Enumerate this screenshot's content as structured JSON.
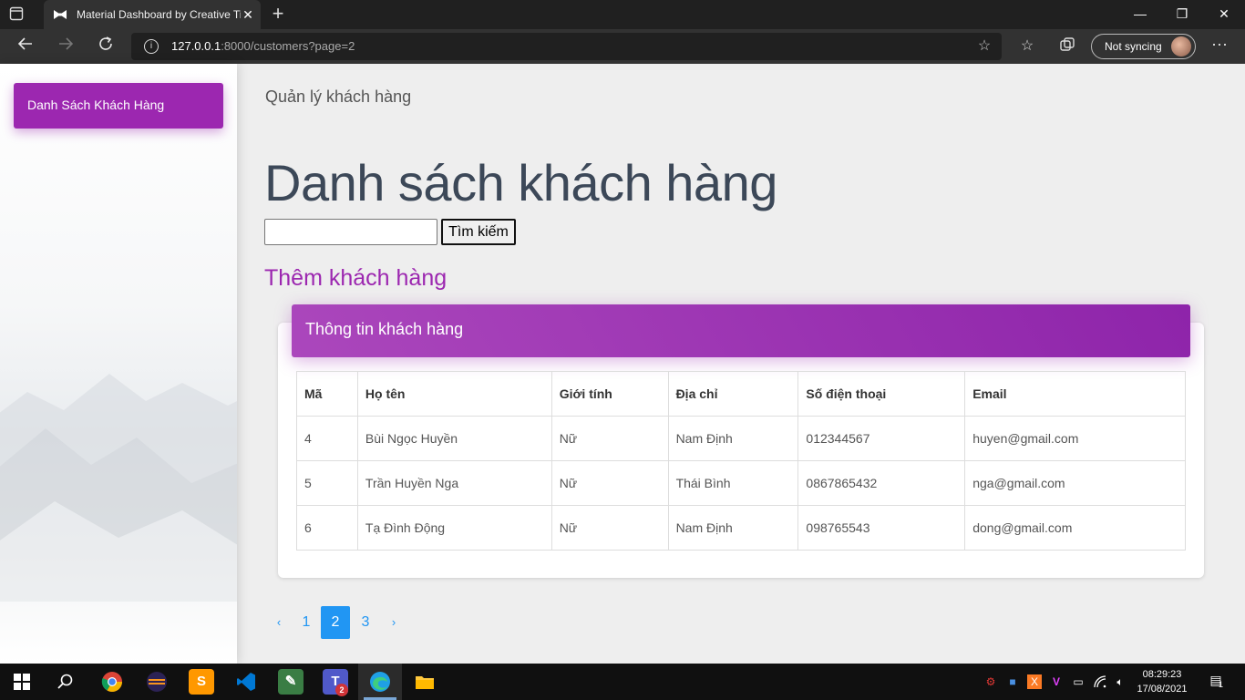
{
  "browser": {
    "tab_title": "Material Dashboard by Creative Tim",
    "tab_close": "✕",
    "new_tab": "+",
    "url_host": "127.0.0.1",
    "url_rest": ":8000/customers?page=2",
    "sync_label": "Not syncing",
    "window_minimize": "—",
    "window_restore": "❐",
    "window_close": "✕"
  },
  "sidebar": {
    "items": [
      {
        "label": "Danh Sách Khách Hàng"
      }
    ]
  },
  "header": {
    "brand": "Quản lý khách hàng"
  },
  "main": {
    "title": "Danh sách khách hàng",
    "search": {
      "value": "",
      "button_label": "Tìm kiếm"
    },
    "add_link": "Thêm khách hàng",
    "card_title": "Thông tin khách hàng",
    "table": {
      "columns": [
        "Mã",
        "Họ tên",
        "Giới tính",
        "Địa chỉ",
        "Số điện thoại",
        "Email"
      ],
      "rows": [
        [
          "4",
          "Bùi Ngọc Huyền",
          "Nữ",
          "Nam Định",
          "012344567",
          "huyen@gmail.com"
        ],
        [
          "5",
          "Trần Huyền Nga",
          "Nữ",
          "Thái Bình",
          "0867865432",
          "nga@gmail.com"
        ],
        [
          "6",
          "Tạ Đình Động",
          "Nữ",
          "Nam Định",
          "098765543",
          "dong@gmail.com"
        ]
      ]
    },
    "pagination": {
      "prev": "‹",
      "pages": [
        "1",
        "2",
        "3"
      ],
      "active": "2",
      "next": "›"
    }
  },
  "taskbar": {
    "time": "08:29:23",
    "date": "17/08/2021",
    "teams_badge": "2",
    "notification_count": "1"
  },
  "colors": {
    "accent_purple": "#9c27b0",
    "link_blue": "#2196f3",
    "title_text": "#3c4858"
  }
}
